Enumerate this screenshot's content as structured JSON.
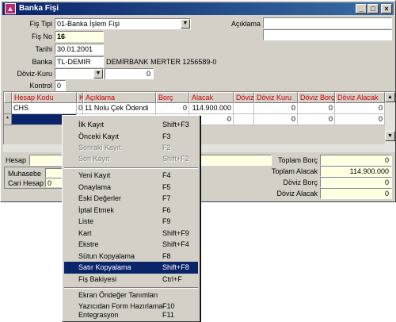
{
  "window": {
    "title": "Banka Fişi",
    "icon": "bank-voucher-icon",
    "controls": {
      "minimize": "_",
      "maximize": "□",
      "close": "×"
    }
  },
  "form": {
    "fis_tipi": {
      "label": "Fiş Tipi",
      "value": "01-Banka İşlem Fişi"
    },
    "fis_no": {
      "label": "Fiş No",
      "value": "16"
    },
    "tarihi": {
      "label": "Tarihi",
      "value": "30.01.2001"
    },
    "banka": {
      "label": "Banka",
      "code": "TL-DEMIR",
      "name": "DEMİRBANK MERTER 1256589-0"
    },
    "doviz_kuru": {
      "label": "Döviz-Kuru",
      "currency": "",
      "rate": "0"
    },
    "kontrol": {
      "label": "Kontrol",
      "value": "0"
    },
    "aciklama": {
      "label": "Açıklama",
      "line1": "",
      "line2": ""
    }
  },
  "grid": {
    "columns": [
      "Hesap Kodu",
      "K",
      "Açıklama",
      "Borç",
      "Alacak",
      "Döviz",
      "Döviz Kuru",
      "Döviz Borç",
      "Döviz Alacak"
    ],
    "rows": [
      {
        "indicator": "",
        "hesap_kodu": "CHS",
        "k": "0",
        "aciklama": "11  Nolu Çek Ödendi",
        "borc": "0",
        "alacak": "114.900.000",
        "doviz": "",
        "doviz_kuru": "0",
        "doviz_borc": "0",
        "doviz_alacak": "0"
      },
      {
        "indicator": "*",
        "hesap_kodu": "",
        "k": "",
        "aciklama": "",
        "borc": "",
        "alacak": "0",
        "doviz": "",
        "doviz_kuru": "0",
        "doviz_borc": "0",
        "doviz_alacak": "0"
      }
    ]
  },
  "bottom": {
    "hesap_label": "Hesap",
    "muhasebe_label": "Muhasebe",
    "cari_hesap_label": "Cari Hesap",
    "cari_hesap_value": "0",
    "totals": [
      {
        "label": "Toplam Borç",
        "value": "0"
      },
      {
        "label": "Toplam Alacak",
        "value": "114.900.000"
      },
      {
        "label": "Döviz Borç",
        "value": "0"
      },
      {
        "label": "Döviz Alacak",
        "value": "0"
      }
    ]
  },
  "context_menu": {
    "groups": [
      [
        {
          "label": "İlk Kayıt",
          "shortcut": "Shift+F3",
          "enabled": true
        },
        {
          "label": "Önceki Kayıt",
          "shortcut": "F3",
          "enabled": true
        },
        {
          "label": "Sonraki Kayıt",
          "shortcut": "F2",
          "enabled": false
        },
        {
          "label": "Son Kayıt",
          "shortcut": "Shift+F2",
          "enabled": false
        }
      ],
      [
        {
          "label": "Yeni Kayıt",
          "shortcut": "F4",
          "enabled": true
        },
        {
          "label": "Onaylama",
          "shortcut": "F5",
          "enabled": true
        },
        {
          "label": "Eski Değerler",
          "shortcut": "F7",
          "enabled": true
        },
        {
          "label": "İptal Etmek",
          "shortcut": "F6",
          "enabled": true
        },
        {
          "label": "Liste",
          "shortcut": "F9",
          "enabled": true
        },
        {
          "label": "Kart",
          "shortcut": "Shift+F9",
          "enabled": true
        },
        {
          "label": "Ekstre",
          "shortcut": "Shift+F4",
          "enabled": true
        },
        {
          "label": "Sütun Kopyalama",
          "shortcut": "F8",
          "enabled": true
        },
        {
          "label": "Satır Kopyalama",
          "shortcut": "Shift+F8",
          "enabled": true,
          "highlighted": true
        },
        {
          "label": "Fiş Bakiyesi",
          "shortcut": "Ctrl+F",
          "enabled": true
        }
      ],
      [
        {
          "label": "Ekran Öndeğer Tanımları",
          "shortcut": "",
          "enabled": true
        },
        {
          "label": "Yazıcıdan Form Hazırlama",
          "shortcut": "F10",
          "enabled": true
        },
        {
          "label": "Entegrasyon",
          "shortcut": "F11",
          "enabled": true
        }
      ]
    ]
  },
  "colors": {
    "title_bar": "#0a246a",
    "highlight": "#0a246a",
    "header_text": "#cc0000",
    "required_field": "#ffffe1",
    "face": "#d4d0c8"
  }
}
